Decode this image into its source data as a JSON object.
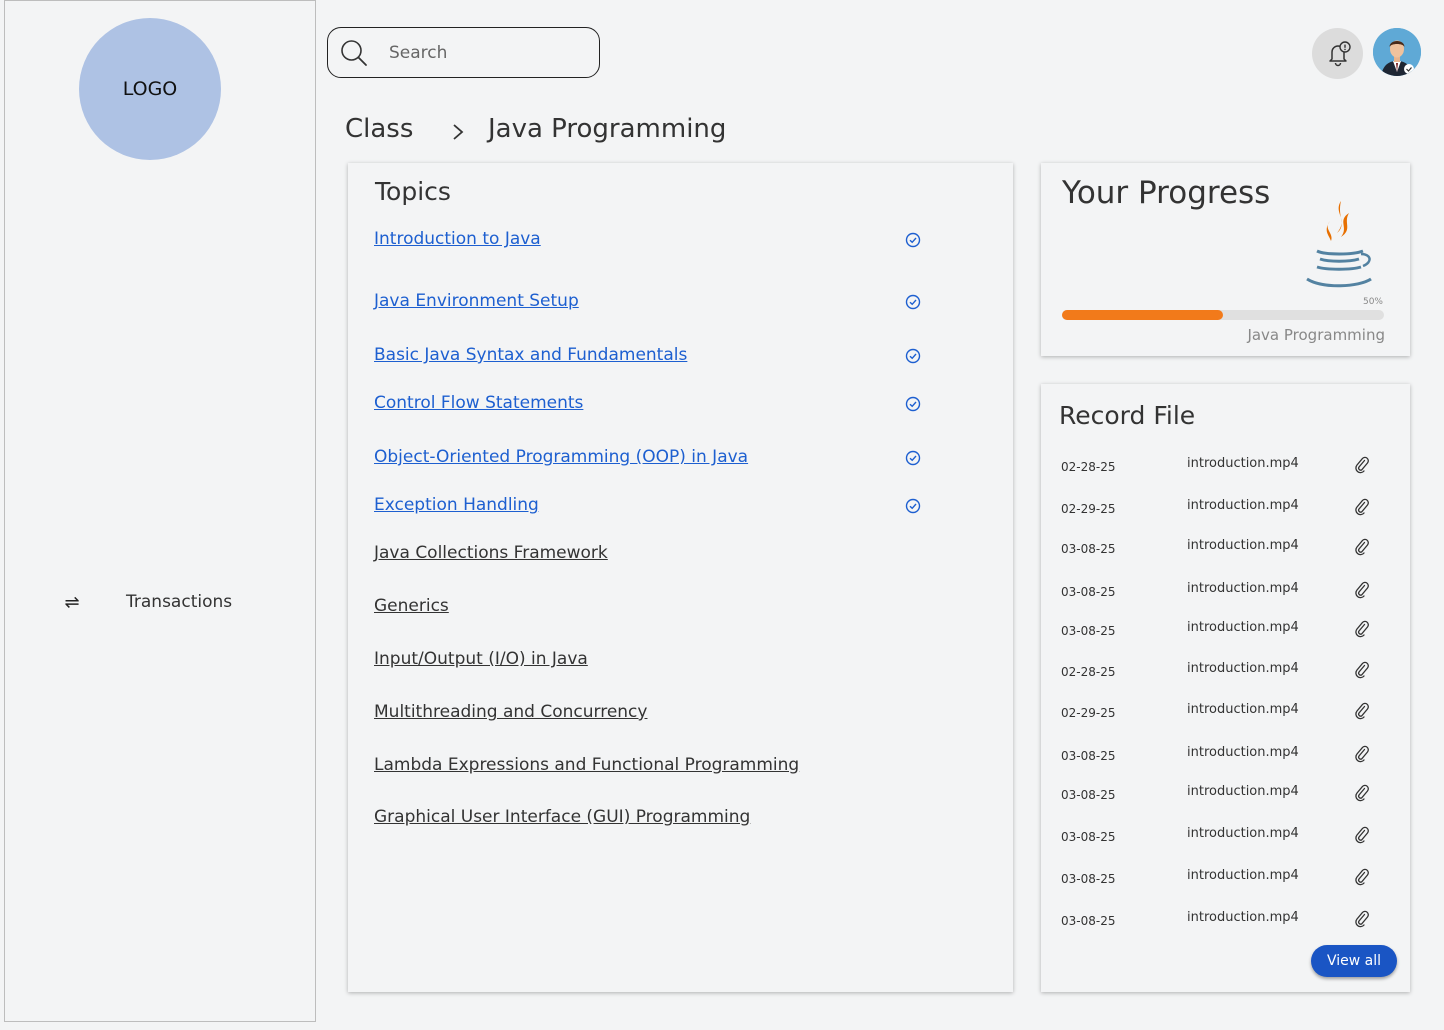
{
  "sidebar": {
    "logo_text": "LOGO",
    "items": [
      {
        "label": "Transactions",
        "icon": "swap-arrows-icon"
      }
    ]
  },
  "header": {
    "search_placeholder": "Search",
    "notification_icon": "bell-alert-icon",
    "avatar_icon": "user-avatar"
  },
  "breadcrumb": {
    "parent": "Class",
    "current": "Java Programming"
  },
  "topics": {
    "title": "Topics",
    "items": [
      {
        "label": "Introduction to Java",
        "completed": true
      },
      {
        "label": "Java Environment Setup",
        "completed": true
      },
      {
        "label": "Basic Java Syntax and Fundamentals",
        "completed": true
      },
      {
        "label": "Control Flow Statements",
        "completed": true
      },
      {
        "label": "Object-Oriented Programming (OOP) in Java",
        "completed": true
      },
      {
        "label": "Exception Handling",
        "completed": true
      },
      {
        "label": "Java Collections Framework",
        "completed": false
      },
      {
        "label": "Generics",
        "completed": false
      },
      {
        "label": "Input/Output (I/O) in Java",
        "completed": false
      },
      {
        "label": "Multithreading and Concurrency",
        "completed": false
      },
      {
        "label": "Lambda Expressions and Functional Programming",
        "completed": false
      },
      {
        "label": "Graphical User Interface (GUI) Programming",
        "completed": false
      }
    ]
  },
  "progress": {
    "title": "Your Progress",
    "percent_label": "50%",
    "percent": 50,
    "course": "Java Programming",
    "bar_color": "#f27a1a"
  },
  "records": {
    "title": "Record File",
    "items": [
      {
        "date": "02-28-25",
        "file": "introduction.mp4"
      },
      {
        "date": "02-29-25",
        "file": "introduction.mp4"
      },
      {
        "date": "03-08-25",
        "file": "introduction.mp4"
      },
      {
        "date": "03-08-25",
        "file": "introduction.mp4"
      },
      {
        "date": "03-08-25",
        "file": "introduction.mp4"
      },
      {
        "date": "02-28-25",
        "file": "introduction.mp4"
      },
      {
        "date": "02-29-25",
        "file": "introduction.mp4"
      },
      {
        "date": "03-08-25",
        "file": "introduction.mp4"
      },
      {
        "date": "03-08-25",
        "file": "introduction.mp4"
      },
      {
        "date": "03-08-25",
        "file": "introduction.mp4"
      },
      {
        "date": "03-08-25",
        "file": "introduction.mp4"
      },
      {
        "date": "03-08-25",
        "file": "introduction.mp4"
      }
    ],
    "view_all_label": "View all"
  },
  "colors": {
    "link_done": "#1d5fd0",
    "accent_button": "#1a55c4",
    "logo_circle": "#aec2e4"
  }
}
